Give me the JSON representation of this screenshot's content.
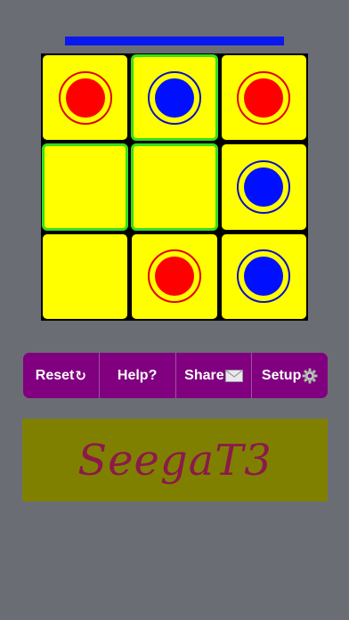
{
  "turn_indicator": {
    "color": "#0a18f0"
  },
  "board": {
    "rows": [
      [
        {
          "piece": "red",
          "highlight": false
        },
        {
          "piece": "blue",
          "highlight": true
        },
        {
          "piece": "red",
          "highlight": false
        }
      ],
      [
        {
          "piece": "",
          "highlight": true
        },
        {
          "piece": "",
          "highlight": true
        },
        {
          "piece": "blue",
          "highlight": false
        }
      ],
      [
        {
          "piece": "",
          "highlight": false
        },
        {
          "piece": "red",
          "highlight": false
        },
        {
          "piece": "blue",
          "highlight": false
        }
      ]
    ]
  },
  "toolbar": {
    "reset_label": "Reset",
    "reset_icon": "↻",
    "help_label": "Help?",
    "share_label": "Share",
    "setup_label": "Setup"
  },
  "logo": {
    "text": "SeegaT3"
  }
}
